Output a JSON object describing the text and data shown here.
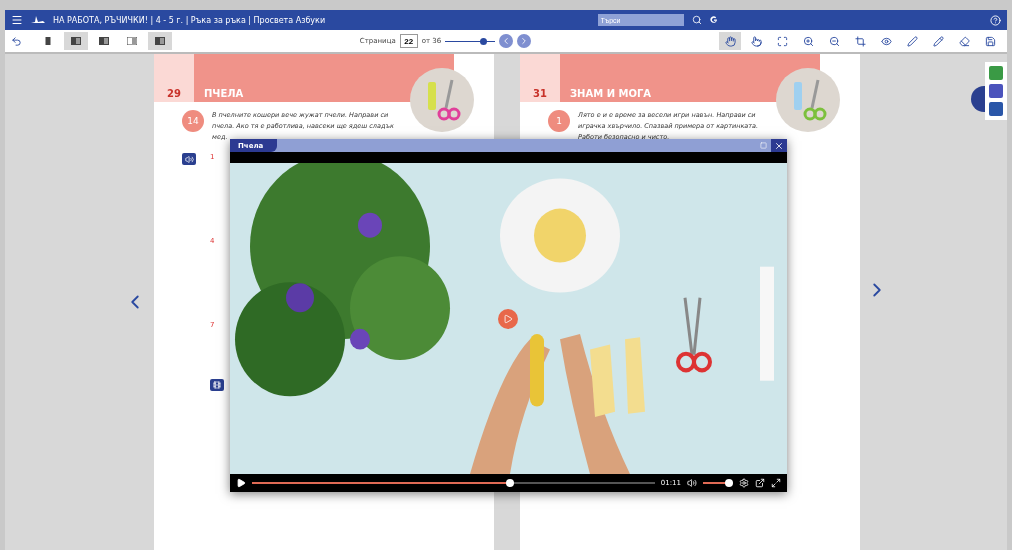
{
  "header": {
    "title": "НА РАБОТА, РЪЧИЧКИ! | 4 - 5 г. | Ръка за ръка | Просвета Азбуки",
    "search": {
      "placeholder": "Търси"
    }
  },
  "toolbar": {
    "view_modes": [
      {
        "selected": false
      },
      {
        "selected": true
      },
      {
        "selected": false
      },
      {
        "selected": false
      },
      {
        "selected": true
      }
    ],
    "page_label": "Страница",
    "page": "22",
    "page_total": "от 36",
    "zoom": {
      "level": 0.75
    },
    "tools": [
      {
        "kind": "hand",
        "selected": true
      },
      {
        "kind": "pointer",
        "selected": false
      },
      {
        "kind": "fullscreen",
        "selected": false
      },
      {
        "kind": "zoom-in",
        "selected": false
      },
      {
        "kind": "zoom-out",
        "selected": false
      },
      {
        "kind": "crop",
        "selected": false
      },
      {
        "kind": "eye",
        "selected": false
      },
      {
        "kind": "pen",
        "selected": false
      },
      {
        "kind": "pencil",
        "selected": false
      },
      {
        "kind": "eraser",
        "selected": false
      },
      {
        "kind": "save",
        "selected": false
      }
    ]
  },
  "pages": [
    {
      "number": "29",
      "title": "ПЧЕЛА",
      "badge": "14",
      "text": "В пчелните кошери вече жужат пчели. Направи си пчела. Ако тя е работлива, навсеки ще ядеш сладък мед.",
      "steps": [
        "1",
        "4",
        "7"
      ]
    },
    {
      "number": "31",
      "title": "ЗНАМ И МОГА",
      "badge": "1",
      "text": "Лято е и е време за весели игри навън. Направи си играчка хвърчило. Спазвай примера от картинката. Работи безопасно и чисто."
    }
  ],
  "video": {
    "title": "Пчела",
    "progress": {
      "level": 0.64
    },
    "time": "01:11",
    "volume": {
      "level": 0.85
    }
  }
}
